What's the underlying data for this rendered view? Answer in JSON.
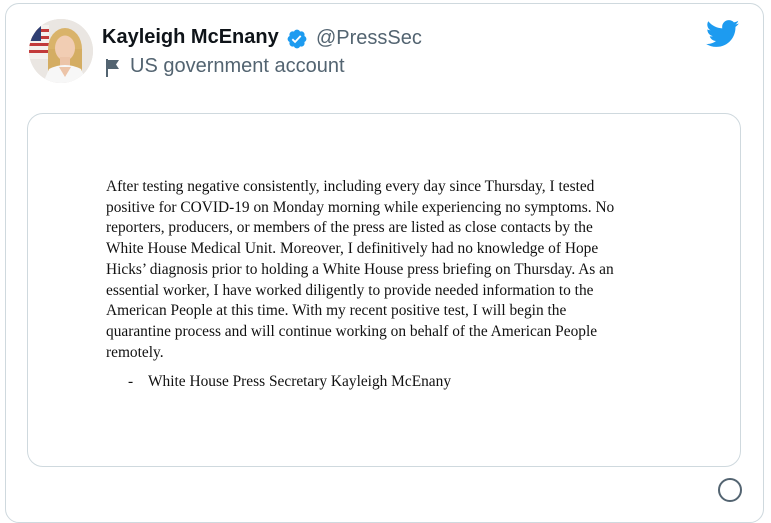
{
  "tweet": {
    "author": {
      "display_name": "Kayleigh McEnany",
      "handle": "@PressSec",
      "verified": true,
      "account_label": "US government account",
      "avatar_icon": "profile-photo",
      "label_icon": "flag-icon"
    },
    "brand_icon": "twitter-bird-icon",
    "brand_color": "#1d9bf0",
    "verified_color": "#1d9bf0",
    "media": {
      "statement": "After testing negative consistently, including every day since Thursday, I tested\npositive for COVID-19 on Monday morning while experiencing no symptoms.  No\nreporters, producers, or members of the press are listed as close contacts by the\nWhite House Medical Unit. Moreover, I definitively had no knowledge of Hope\nHicks’ diagnosis prior to holding a White House press briefing on Thursday. As an\nessential worker, I have worked diligently to provide needed information to the\nAmerican People at this time. With my recent positive test, I will begin the\nquarantine process and will continue working on behalf of the American People\nremotely.",
      "signature_dash": "-",
      "signature": "White House Press Secretary Kayleigh McEnany"
    }
  }
}
